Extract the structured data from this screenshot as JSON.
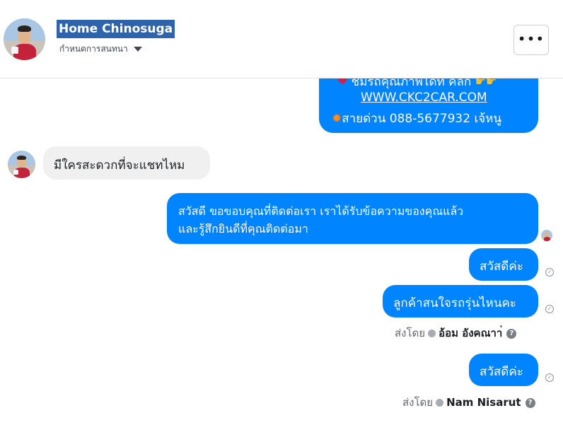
{
  "header": {
    "page_name": "Home Chinosuga",
    "subtitle": "กำหนดการสนทนา",
    "more_label": "•••"
  },
  "messages": {
    "ig_card": {
      "line1": "ชมรถคุณภาพได้ที่ คลิก",
      "line2": "WWW.CKC2CAR.COM",
      "line3": "สายด่วน 088-5677932 เจ้หนู"
    },
    "incoming_1": "มีใครสะดวกที่จะแชทไหม",
    "outgoing_1_line1": "สวัสดี ขอขอบคุณที่ติดต่อเรา เราได้รับข้อความของคุณแล้ว",
    "outgoing_1_line2": "และรู้สึกยินดีที่คุณติดต่อมา",
    "outgoing_2": "สวัสดีค่ะ",
    "outgoing_3": "ลูกค้าสนใจรถรุ่นไหนคะ",
    "sent_by_1_prefix": "ส่งโดย",
    "sent_by_1_name": "อ้อม อังคณาา่",
    "outgoing_4": "สวัสดีค่ะ",
    "sent_by_2_prefix": "ส่งโดย",
    "sent_by_2_name": "Nam Nisarut"
  },
  "colors": {
    "accent": "#0084ff",
    "header_highlight": "#2d64ac",
    "incoming_bubble": "#f0f0f0"
  }
}
